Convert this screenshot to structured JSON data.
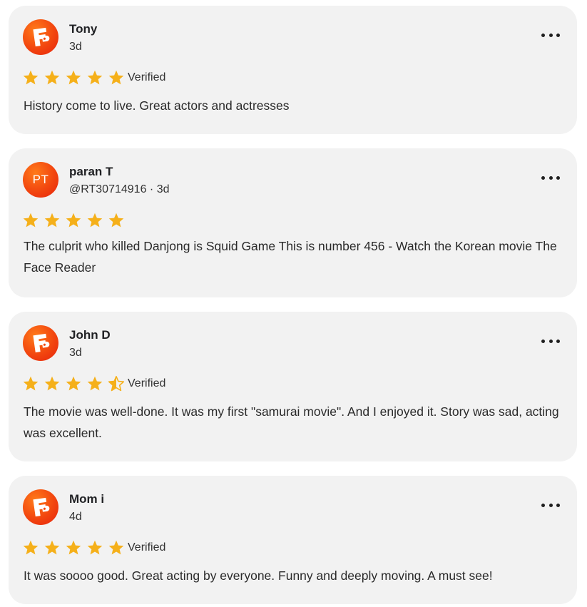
{
  "reviews": [
    {
      "avatar": {
        "type": "logo",
        "icon": "fandango-logo-icon"
      },
      "name": "Tony",
      "meta": "3d",
      "rating": 5,
      "verified": "Verified",
      "text": "History come to live. Great actors and actresses"
    },
    {
      "avatar": {
        "type": "initials",
        "initials": "PT"
      },
      "name": "paran T",
      "meta": "@RT30714916 · 3d",
      "rating": 5,
      "verified": "",
      "text": "The culprit who killed Danjong is Squid Game This is number 456 - Watch the Korean movie The Face Reader"
    },
    {
      "avatar": {
        "type": "logo",
        "icon": "fandango-logo-icon"
      },
      "name": "John D",
      "meta": "3d",
      "rating": 4.5,
      "verified": "Verified",
      "text": "The movie was well-done. It was my first \"samurai movie\". And I enjoyed it. Story was sad, acting was excellent."
    },
    {
      "avatar": {
        "type": "logo",
        "icon": "fandango-logo-icon"
      },
      "name": "Mom i",
      "meta": "4d",
      "rating": 5,
      "verified": "Verified",
      "text": "It was soooo good. Great acting by everyone. Funny and deeply moving. A must see!"
    }
  ],
  "icons": {
    "star": "star-icon",
    "half_star": "half-star-icon",
    "more": "more-options-icon"
  },
  "colors": {
    "card_background": "#f2f2f2",
    "star": "#f5b01a",
    "avatar_gradient_start": "#ff7a1a",
    "avatar_gradient_end": "#e6220c"
  }
}
